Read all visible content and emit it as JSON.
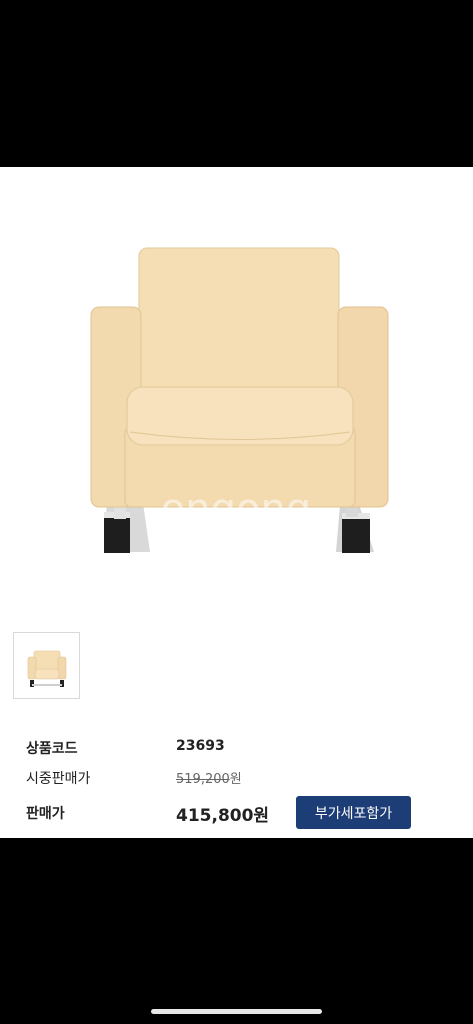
{
  "product_image": {
    "alt": "armchair",
    "watermark": "ongong"
  },
  "info": {
    "code_label": "상품코드",
    "code_value": "23693",
    "retail_label": "시중판매가",
    "retail_value": "519,200",
    "retail_unit": "원",
    "sale_label": "판매가",
    "sale_value": "415,800원",
    "vat_button": "부가세포함가"
  },
  "colors": {
    "button_bg": "#1d3d76",
    "chair": "#f4dcb1"
  }
}
